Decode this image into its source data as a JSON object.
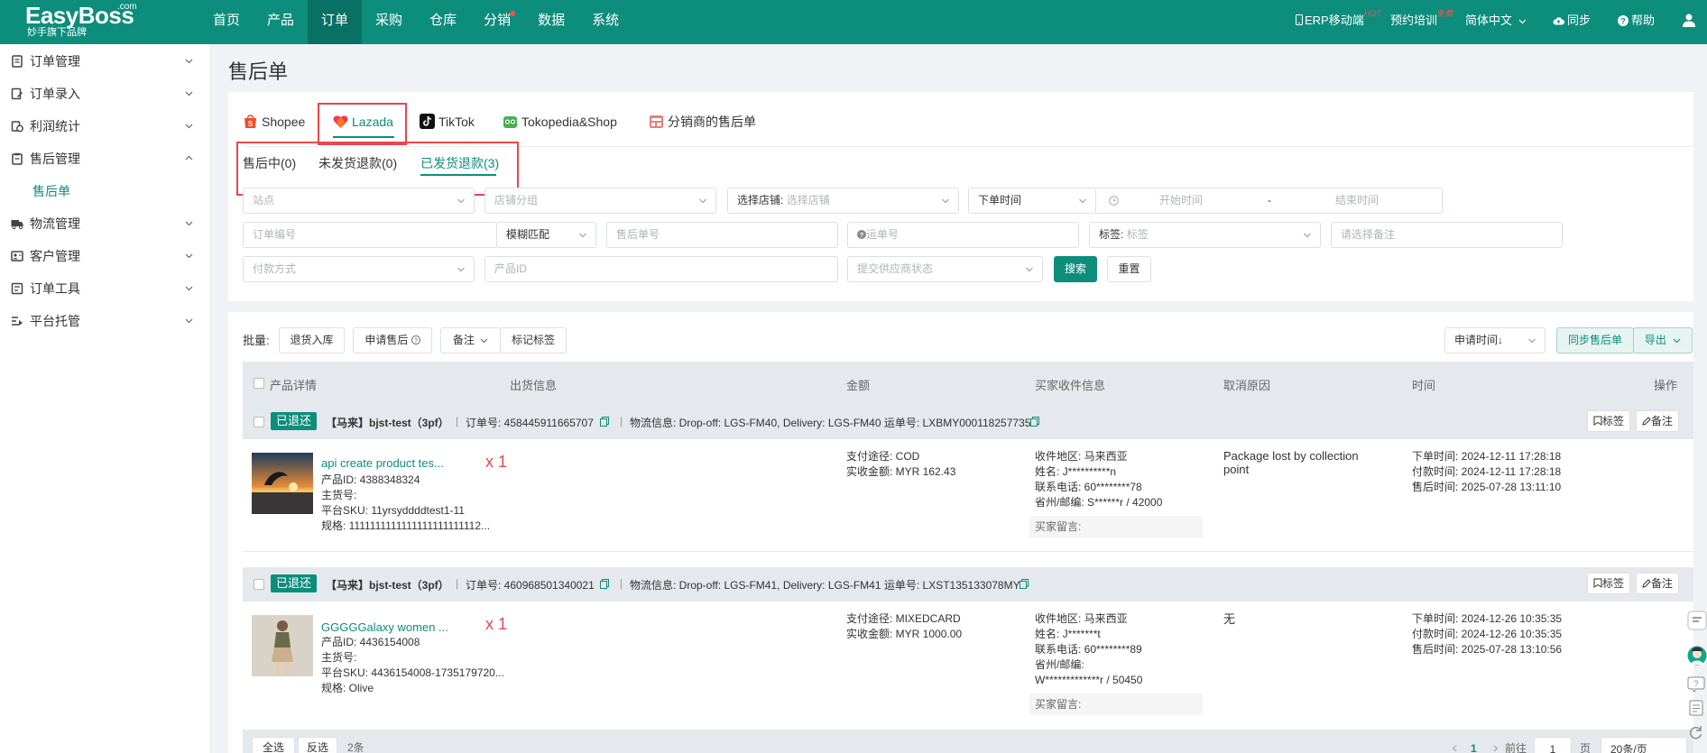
{
  "app": {
    "logo_main": "EasyBoss",
    "logo_com": ".com",
    "logo_sub": "妙手旗下品牌"
  },
  "topnav": {
    "items": [
      {
        "label": "首页",
        "active": false
      },
      {
        "label": "产品",
        "active": false
      },
      {
        "label": "订单",
        "active": true
      },
      {
        "label": "采购",
        "active": false
      },
      {
        "label": "仓库",
        "active": false
      },
      {
        "label": "分销",
        "active": false,
        "dot": true
      },
      {
        "label": "数据",
        "active": false
      },
      {
        "label": "系统",
        "active": false
      }
    ],
    "erp_mobile": "ERP移动端",
    "erp_badge": "HOT",
    "training": "预约培训",
    "training_badge": "免费",
    "language": "简体中文",
    "sync": "同步",
    "help": "帮助"
  },
  "sidebar": {
    "items": [
      {
        "label": "订单管理",
        "icon": "order-icon"
      },
      {
        "label": "订单录入",
        "icon": "edit-icon"
      },
      {
        "label": "利润统计",
        "icon": "coin-icon"
      },
      {
        "label": "售后管理",
        "icon": "clipboard-icon",
        "expanded": true
      },
      {
        "label": "物流管理",
        "icon": "truck-icon"
      },
      {
        "label": "客户管理",
        "icon": "customer-icon"
      },
      {
        "label": "订单工具",
        "icon": "tool-icon"
      },
      {
        "label": "平台托管",
        "icon": "hosting-icon"
      }
    ],
    "subitem": "售后单"
  },
  "page": {
    "title": "售后单"
  },
  "platform_tabs": [
    {
      "label": "Shopee",
      "icon": "shopee-icon"
    },
    {
      "label": "Lazada",
      "icon": "lazada-icon",
      "active": true
    },
    {
      "label": "TikTok",
      "icon": "tiktok-icon"
    },
    {
      "label": "Tokopedia&Shop",
      "icon": "tokopedia-icon"
    },
    {
      "label": "分销商的售后单",
      "icon": "distributor-icon"
    }
  ],
  "status_tabs": [
    {
      "label": "售后中(0)"
    },
    {
      "label": "未发货退款(0)"
    },
    {
      "label": "已发货退款(3)",
      "active": true
    }
  ],
  "filters": {
    "site": "站点",
    "shop_group": "店铺分组",
    "shop_label": "选择店铺:",
    "shop_placeholder": "选择店铺",
    "time_type": "下单时间",
    "start_time": "开始时间",
    "time_sep": "-",
    "end_time": "结束时间",
    "order_no": "订单编号",
    "match_mode": "模糊匹配",
    "aftersale_no": "售后单号",
    "waybill_no": "运单号",
    "tag_label": "标签:",
    "tag_placeholder": "标签",
    "remark": "请选择备注",
    "payment": "付款方式",
    "product_id": "产品ID",
    "supplier_status": "提交供应商状态",
    "search": "搜索",
    "reset": "重置"
  },
  "toolbar": {
    "batch": "批量:",
    "return_stock": "退货入库",
    "apply_aftersale": "申请售后",
    "remark": "备注",
    "mark_tag": "标记标签",
    "sort": "申请时间↓",
    "sync_aftersale": "同步售后单",
    "export": "导出"
  },
  "table_headers": [
    "产品详情",
    "出货信息",
    "金额",
    "买家收件信息",
    "取消原因",
    "时间",
    "操作"
  ],
  "orders": [
    {
      "status": "已退还",
      "shop": "【马来】bjst-test（3pf）",
      "order_no": "订单号: 458445911665707",
      "logistics": "物流信息: Drop-off: LGS-FM40, Delivery: LGS-FM40 运单号: LXBMY000118257735",
      "tag_btn": "标签",
      "note_btn": "备注",
      "product_name": "api create product tes...",
      "qty": "x 1",
      "product_id": "产品ID: 4388348324",
      "main_sku": "主货号:",
      "platform_sku": "平台SKU: 11yrsyddddtest1-11",
      "spec": "规格: 1111111111111111111111112...",
      "pay_method": "支付途径: COD",
      "paid_amount": "实收金额: MYR 162.43",
      "region": "收件地区: 马来西亚",
      "name": "姓名: J**********n",
      "phone": "联系电话: 60********78",
      "province": "省州/邮编: S******r / 42000",
      "buyer_note": "买家留言:",
      "cancel_reason": "Package lost by collection point",
      "order_time": "下单时间: 2024-12-11 17:28:18",
      "pay_time": "付款时间: 2024-12-11 17:28:18",
      "aftersale_time": "售后时间: 2025-07-28 13:11:10"
    },
    {
      "status": "已退还",
      "shop": "【马来】bjst-test（3pf）",
      "order_no": "订单号: 460968501340021",
      "logistics": "物流信息: Drop-off: LGS-FM41, Delivery: LGS-FM41 运单号: LXST135133078MY",
      "tag_btn": "标签",
      "note_btn": "备注",
      "product_name": "GGGGGalaxy women ...",
      "qty": "x 1",
      "product_id": "产品ID: 4436154008",
      "main_sku": "主货号:",
      "platform_sku": "平台SKU: 4436154008-1735179720...",
      "spec": "规格: Olive",
      "pay_method": "支付途径: MIXEDCARD",
      "paid_amount": "实收金额: MYR 1000.00",
      "region": "收件地区: 马来西亚",
      "name": "姓名: J*******t",
      "phone": "联系电话: 60********89",
      "province": "省州/邮编:",
      "province2": "W*************r / 50450",
      "buyer_note": "买家留言:",
      "cancel_reason": "无",
      "order_time": "下单时间: 2024-12-26 10:35:35",
      "pay_time": "付款时间: 2024-12-26 10:35:35",
      "aftersale_time": "售后时间: 2025-07-28 13:10:56"
    }
  ],
  "footer": {
    "select_all": "全选",
    "invert": "反选",
    "count": "2条",
    "page": "1",
    "goto": "前往",
    "goto_page": "1",
    "page_unit": "页",
    "page_size": "20条/页"
  },
  "colors": {
    "primary": "#0d8d7c",
    "highlight_red": "#e5484d"
  }
}
